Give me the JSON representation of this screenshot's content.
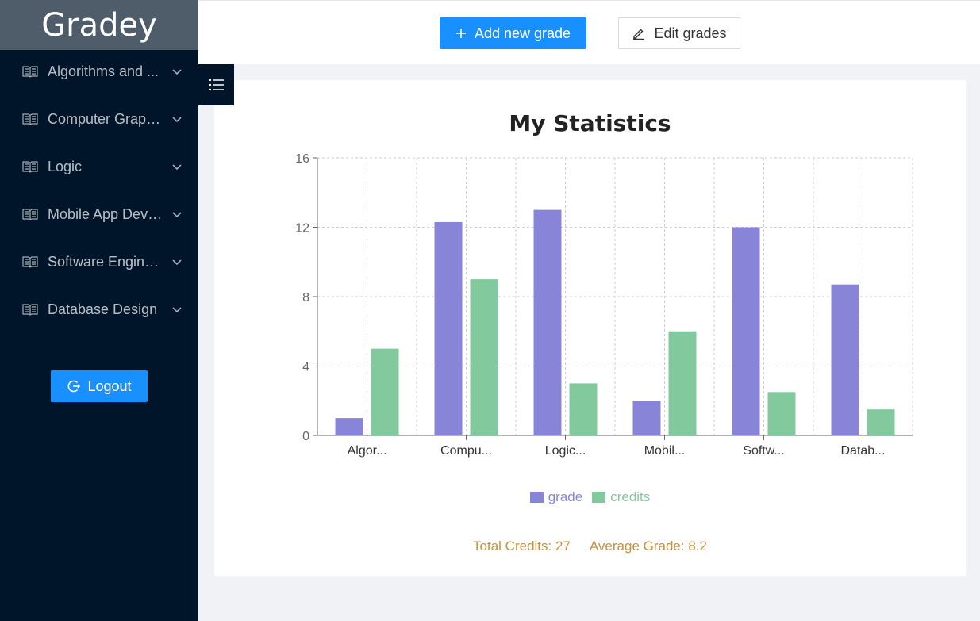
{
  "app": {
    "brand": "Gradey"
  },
  "sidebar": {
    "items": [
      {
        "label": "Algorithms and ..."
      },
      {
        "label": "Computer Graphi..."
      },
      {
        "label": "Logic"
      },
      {
        "label": "Mobile App Deve..."
      },
      {
        "label": "Software Enginee..."
      },
      {
        "label": "Database Design"
      }
    ],
    "logout_label": "Logout"
  },
  "toolbar": {
    "add_label": "Add new grade",
    "edit_label": "Edit grades"
  },
  "colors": {
    "primary": "#1890ff",
    "sidebar_bg": "#001529",
    "grade": "#8884d8",
    "credits": "#82ca9d",
    "summary_text": "#c8923a"
  },
  "summary": {
    "total_credits": "Total Credits: 27",
    "average_grade": "Average Grade: 8.2"
  },
  "chart_data": {
    "type": "bar",
    "title": "My Statistics",
    "categories": [
      "Algor...",
      "Compu...",
      "Logic...",
      "Mobil...",
      "Softw...",
      "Datab..."
    ],
    "series": [
      {
        "name": "grade",
        "color": "#8884d8",
        "values": [
          1,
          12.3,
          13,
          2,
          12,
          8.7
        ]
      },
      {
        "name": "credits",
        "color": "#82ca9d",
        "values": [
          5,
          9,
          3,
          6,
          2.5,
          1.5
        ]
      }
    ],
    "yticks": [
      0,
      4,
      8,
      12,
      16
    ],
    "ylim": [
      0,
      16
    ],
    "grid": true,
    "legend_position": "bottom"
  }
}
